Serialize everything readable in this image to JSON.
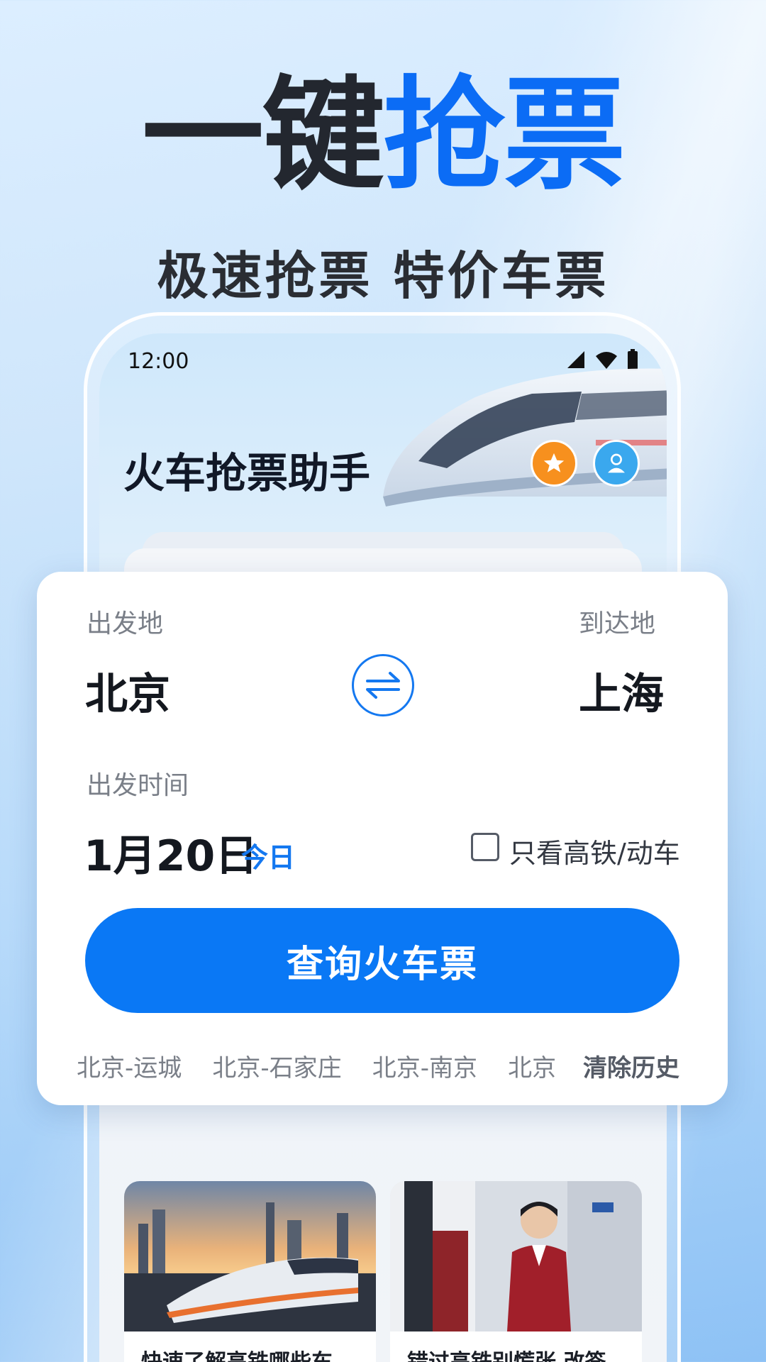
{
  "promo": {
    "headline_dark": "一键",
    "headline_blue": "抢票",
    "subheadline": "极速抢票 特价车票"
  },
  "status_bar": {
    "time": "12:00",
    "icons": [
      "signal-icon",
      "wifi-icon",
      "battery-icon"
    ]
  },
  "app": {
    "title": "火车抢票助手",
    "header_buttons": [
      "star-icon",
      "user-icon"
    ]
  },
  "search_card": {
    "from_label": "出发地",
    "from_city": "北京",
    "to_label": "到达地",
    "to_city": "上海",
    "date_label": "出发时间",
    "date_value": "1月20日",
    "date_tag": "今日",
    "high_speed_only_label": "只看高铁/动车",
    "high_speed_only_checked": false,
    "search_button": "查询火车票",
    "history": [
      "北京-运城",
      "北京-石家庄",
      "北京-南京",
      "北京"
    ],
    "clear_history": "清除历史"
  },
  "news": [
    {
      "title": "快速了解高铁哪些车"
    },
    {
      "title": "错过高铁别慌张 改签"
    }
  ],
  "colors": {
    "accent": "#0a78f5",
    "headline_blue": "#0b6cf5",
    "star_badge": "#f7901e",
    "user_badge": "#3aa8ee"
  }
}
